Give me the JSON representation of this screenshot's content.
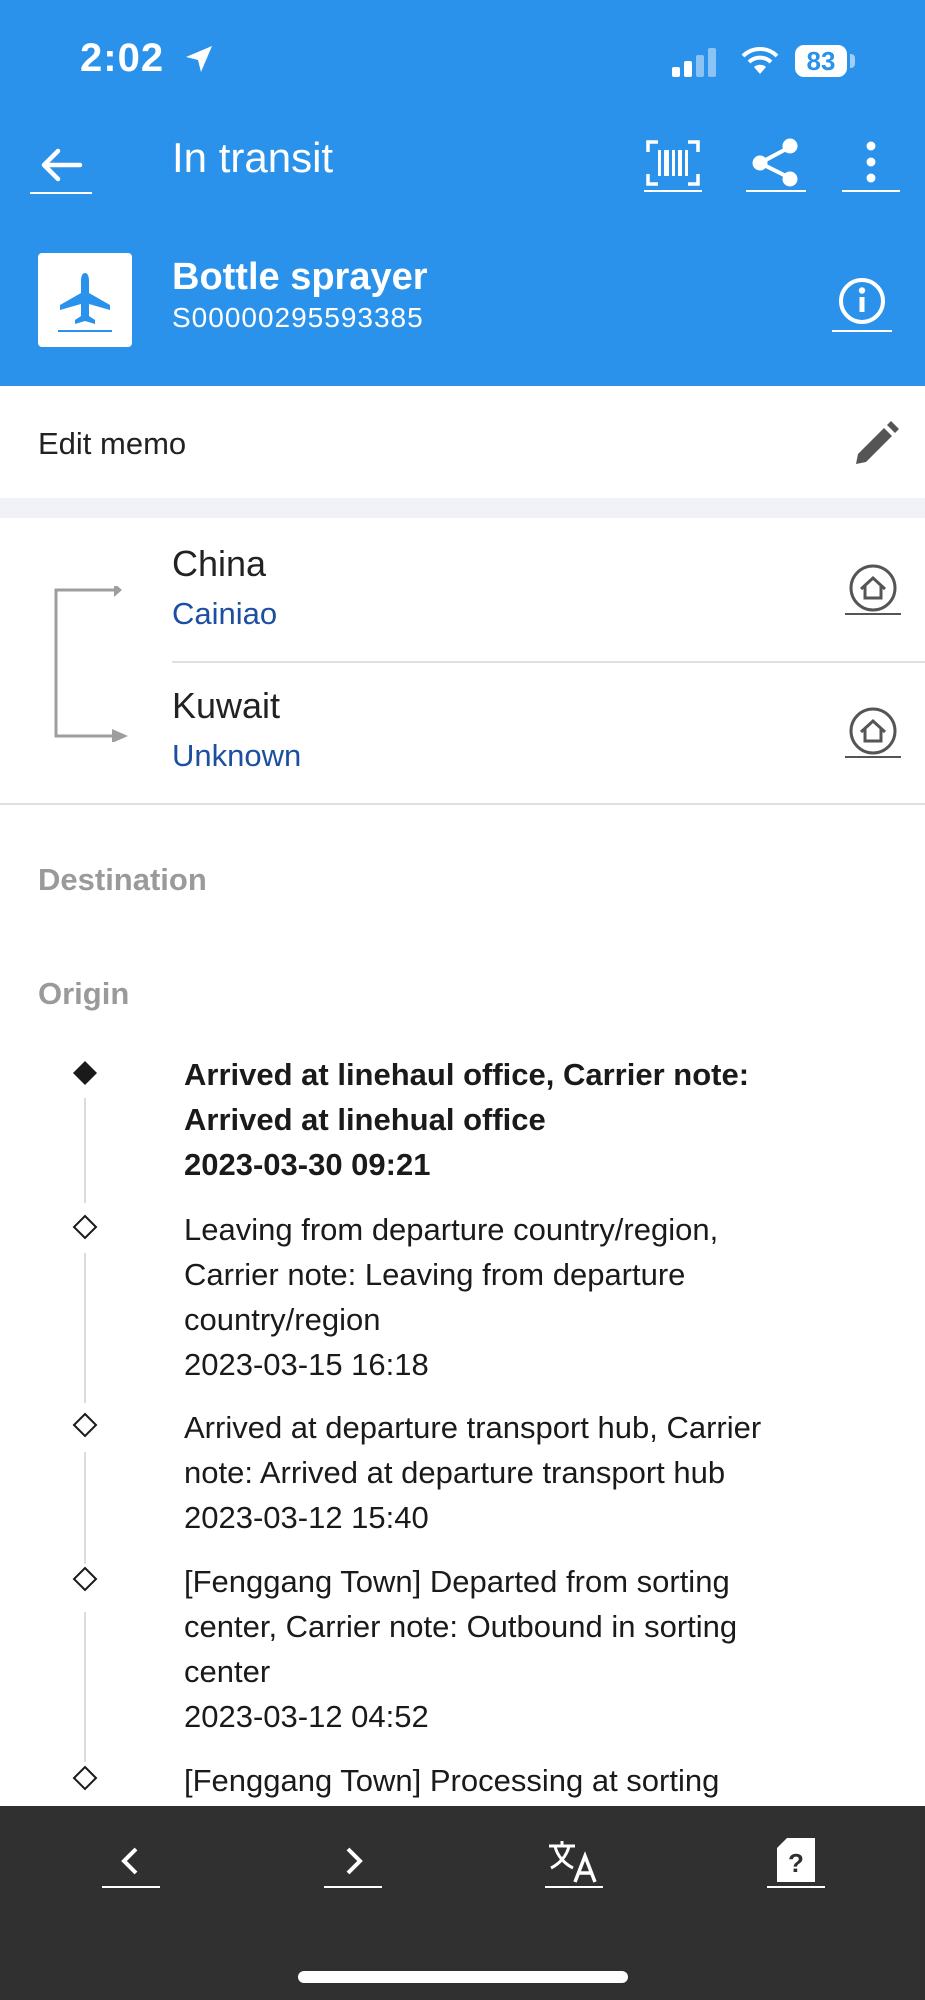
{
  "status_bar": {
    "time": "2:02",
    "battery": "83"
  },
  "header": {
    "title": "In transit",
    "package_name": "Bottle sprayer",
    "tracking_number": "S00000295593385"
  },
  "memo": {
    "label": "Edit memo"
  },
  "route": {
    "origin": {
      "country": "China",
      "carrier": "Cainiao"
    },
    "destination": {
      "country": "Kuwait",
      "carrier": "Unknown"
    }
  },
  "sections": {
    "destination_label": "Destination",
    "origin_label": "Origin"
  },
  "events": [
    {
      "lines": [
        "Arrived at linehaul office, Carrier note:",
        "Arrived at linehual office",
        "2023-03-30 09:21"
      ],
      "latest": true
    },
    {
      "lines": [
        "Leaving from departure country/region,",
        "Carrier note: Leaving from departure",
        "country/region",
        "2023-03-15 16:18"
      ],
      "latest": false
    },
    {
      "lines": [
        "Arrived at departure transport hub, Carrier",
        "note: Arrived at departure transport hub",
        "2023-03-12 15:40"
      ],
      "latest": false
    },
    {
      "lines": [
        "[Fenggang Town] Departed from sorting",
        "center, Carrier note: Outbound in sorting",
        "center",
        "2023-03-12 04:52"
      ],
      "latest": false
    },
    {
      "lines": [
        "[Fenggang Town] Processing at sorting"
      ],
      "latest": false
    }
  ],
  "icons": {
    "back": "arrow-left-icon",
    "barcode": "barcode-icon",
    "share": "share-icon",
    "more": "more-vertical-icon",
    "plane": "airplane-icon",
    "info": "info-icon",
    "edit": "pencil-icon",
    "home": "home-icon",
    "prev": "chevron-left-icon",
    "next": "chevron-right-icon",
    "translate": "translate-icon",
    "help": "help-icon"
  },
  "colors": {
    "primary": "#2a92eb",
    "carrier_link": "#1c4fa0",
    "bottom_bar": "#303030"
  }
}
